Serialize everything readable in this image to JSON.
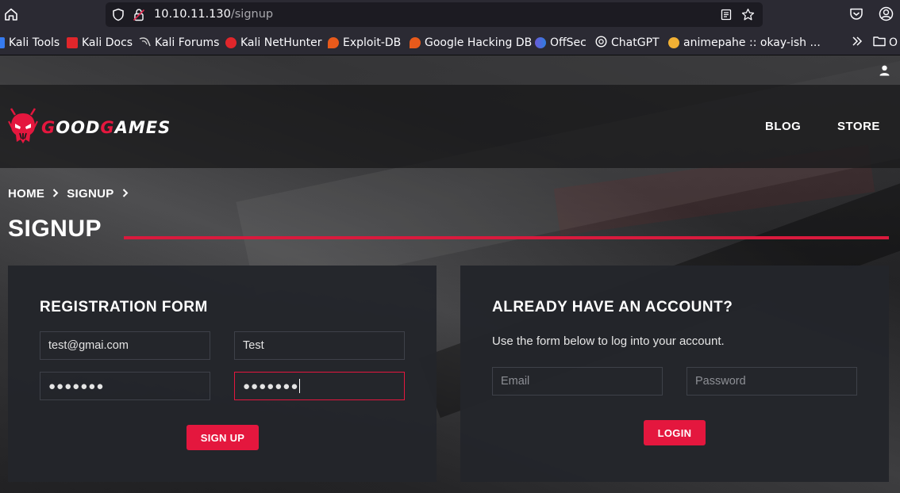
{
  "browser": {
    "url_host": "10.10.11.130",
    "url_path": "/signup",
    "bookmarks": [
      {
        "label": "Kali Tools",
        "icon": "kali-tools-icon",
        "color": "#367bf0"
      },
      {
        "label": "Kali Docs",
        "icon": "kali-docs-icon",
        "color": "#e0262b"
      },
      {
        "label": "Kali Forums",
        "icon": "kali-forums-icon",
        "color": "#cfcfcf"
      },
      {
        "label": "Kali NetHunter",
        "icon": "kali-nethunter-icon",
        "color": "#e0262b"
      },
      {
        "label": "Exploit-DB",
        "icon": "exploit-db-icon",
        "color": "#e85a1b"
      },
      {
        "label": "Google Hacking DB",
        "icon": "ghdb-icon",
        "color": "#e85a1b"
      },
      {
        "label": "OffSec",
        "icon": "offsec-icon",
        "color": "#6b5bd6"
      },
      {
        "label": "ChatGPT",
        "icon": "chatgpt-icon",
        "color": "#ffffff"
      },
      {
        "label": "animepahe :: okay-ish ...",
        "icon": "animepahe-icon",
        "color": "#f2b134"
      }
    ],
    "other_bookmarks_label": "O"
  },
  "site": {
    "logo_part1": "G",
    "logo_part2": "OOD",
    "logo_part3": "G",
    "logo_part4": "AMES",
    "nav": {
      "blog": "BLOG",
      "store": "STORE"
    },
    "breadcrumb": {
      "home": "HOME",
      "current": "SIGNUP"
    },
    "page_title": "SIGNUP",
    "accent": "#e4173e"
  },
  "registration": {
    "title": "REGISTRATION FORM",
    "email_value": "test@gmai.com",
    "name_value": "Test",
    "password_value": "●●●●●●●",
    "confirm_value": "●●●●●●●",
    "submit_label": "SIGN UP"
  },
  "login": {
    "title": "ALREADY HAVE AN ACCOUNT?",
    "description": "Use the form below to log into your account.",
    "email_placeholder": "Email",
    "password_placeholder": "Password",
    "submit_label": "LOGIN"
  }
}
